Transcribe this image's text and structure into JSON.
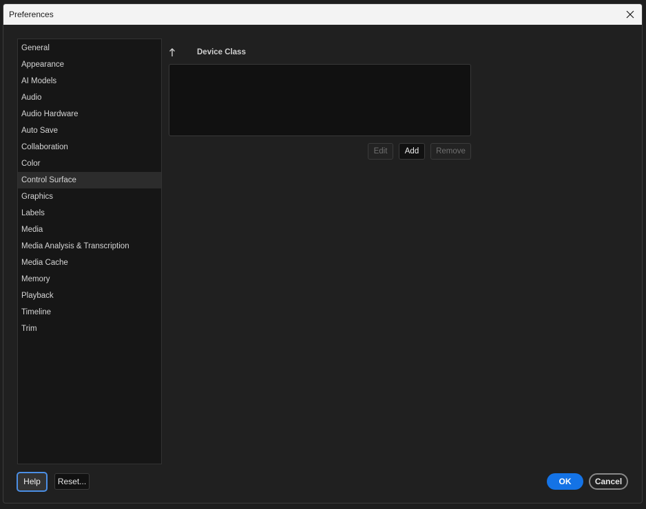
{
  "window": {
    "title": "Preferences",
    "close_icon": "close-icon"
  },
  "sidebar": {
    "selected": "Control Surface",
    "items": [
      {
        "label": "General"
      },
      {
        "label": "Appearance"
      },
      {
        "label": "AI Models"
      },
      {
        "label": "Audio"
      },
      {
        "label": "Audio Hardware"
      },
      {
        "label": "Auto Save"
      },
      {
        "label": "Collaboration"
      },
      {
        "label": "Color"
      },
      {
        "label": "Control Surface"
      },
      {
        "label": "Graphics"
      },
      {
        "label": "Labels"
      },
      {
        "label": "Media"
      },
      {
        "label": "Media Analysis & Transcription"
      },
      {
        "label": "Media Cache"
      },
      {
        "label": "Memory"
      },
      {
        "label": "Playback"
      },
      {
        "label": "Timeline"
      },
      {
        "label": "Trim"
      }
    ]
  },
  "control_surface": {
    "sort_icon": "arrow-up-icon",
    "column_header": "Device Class",
    "devices": [],
    "edit_label": "Edit",
    "add_label": "Add",
    "remove_label": "Remove"
  },
  "footer": {
    "help_label": "Help",
    "reset_label": "Reset...",
    "ok_label": "OK",
    "cancel_label": "Cancel"
  },
  "colors": {
    "accent": "#1473e6",
    "focus_ring": "#4b8fe6",
    "background": "#202020",
    "panel": "#161616"
  }
}
